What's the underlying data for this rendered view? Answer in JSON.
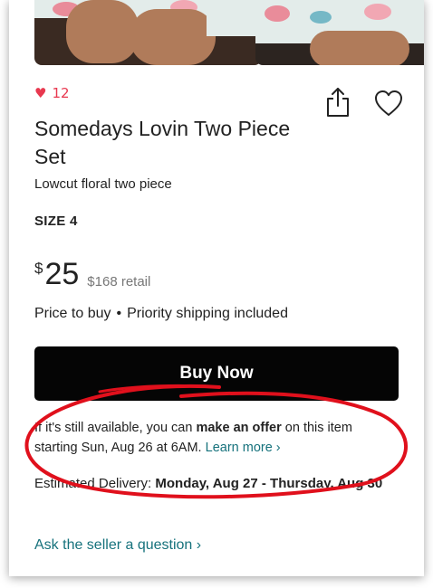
{
  "listing": {
    "like_count": "12",
    "title": "Somedays Lovin Two Piece Set",
    "description": "Lowcut floral two piece",
    "size": "SIZE 4",
    "price_currency": "$",
    "price_amount": "25",
    "retail": "$168 retail",
    "price_note": "Price to buy",
    "separator": "•",
    "shipping_note": "Priority shipping included"
  },
  "actions": {
    "buy_label": "Buy Now",
    "ask_label": "Ask the seller a question ›"
  },
  "offer": {
    "text_1": "If it's still available, you can ",
    "text_bold": "make an offer",
    "text_2": " on this item starting Sun, Aug 26 at 6AM. ",
    "link": "Learn more ›"
  },
  "delivery": {
    "label": "Estimated Delivery: ",
    "dates": "Monday, Aug 27 - Thursday, Aug 30"
  },
  "icons": {
    "like": "heart-icon",
    "share": "share-icon",
    "favorite": "heart-outline-icon"
  },
  "colors": {
    "like": "#e8384f",
    "link": "#16727c",
    "button": "#050505",
    "annotation": "#e0101c"
  }
}
